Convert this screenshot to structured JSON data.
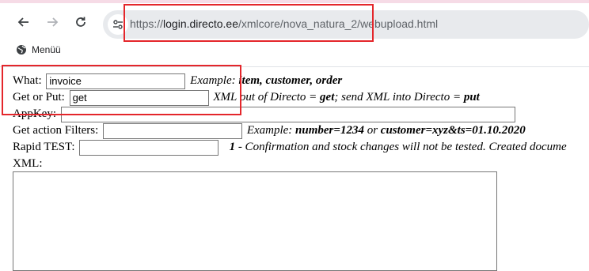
{
  "browser": {
    "url_scheme": "https://",
    "url_host": "login.directo.ee",
    "url_path": "/xmlcore/nova_natura_2/webupload.html",
    "bookmark_label": "Menüü"
  },
  "form": {
    "what": {
      "label": "What:",
      "value": "invoice",
      "hint_prefix": "Example:",
      "hint_bold": "item, customer, order"
    },
    "getput": {
      "label": "Get or Put:",
      "value": "get",
      "hint_1": "XML out of Directo = ",
      "hint_b1": "get",
      "hint_2": "; send XML into Directo = ",
      "hint_b2": "put"
    },
    "appkey": {
      "label": "AppKey:",
      "value": ""
    },
    "filters": {
      "label": "Get action Filters:",
      "value": "",
      "hint_prefix": "Example: ",
      "hint_b1": "number=1234",
      "hint_mid": " or ",
      "hint_b2": "customer=xyz&ts=01.10.2020"
    },
    "rapid": {
      "label": "Rapid TEST:",
      "value": "",
      "hint_b": "1",
      "hint_text": " - Confirmation and stock changes will not be tested. Created docume"
    },
    "xml": {
      "label": "XML:",
      "value": ""
    }
  }
}
